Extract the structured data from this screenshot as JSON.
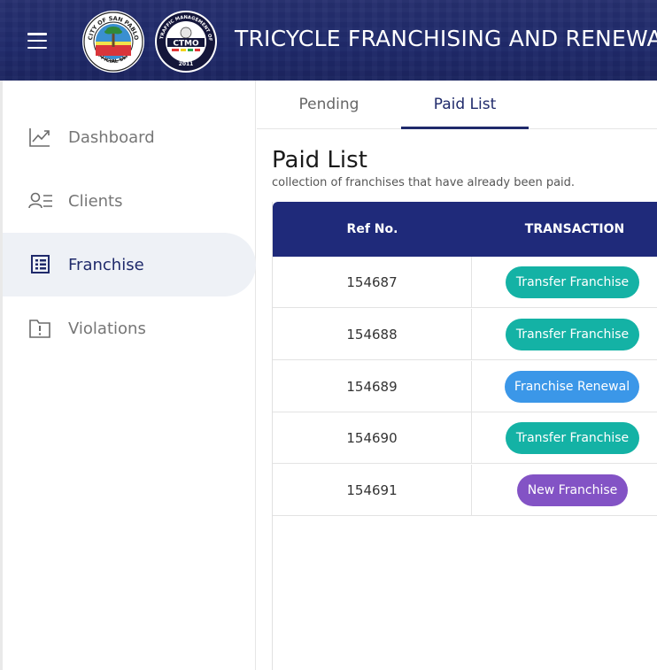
{
  "header": {
    "title": "TRICYCLE FRANCHISING AND RENEWAL",
    "menu_icon": "hamburger-menu-icon",
    "seal1_text": [
      "CITY OF SAN PABLO",
      "OFFICIAL SEAL"
    ],
    "seal2_text": [
      "CITY TRAFFIC MANAGEMENT OFFICE",
      "CTMO",
      "2011"
    ]
  },
  "sidebar": {
    "items": [
      {
        "label": "Dashboard",
        "icon": "trending-up-icon"
      },
      {
        "label": "Clients",
        "icon": "clients-list-icon"
      },
      {
        "label": "Franchise",
        "icon": "list-document-icon",
        "active": true
      },
      {
        "label": "Violations",
        "icon": "folder-alert-icon"
      }
    ]
  },
  "tabs": [
    {
      "label": "Pending"
    },
    {
      "label": "Paid List",
      "active": true
    }
  ],
  "main": {
    "title": "Paid List",
    "subtitle": "collection of franchises that have already been paid."
  },
  "table": {
    "headers": [
      "Ref No.",
      "TRANSACTION"
    ],
    "rows": [
      {
        "ref": "154687",
        "transaction": "Transfer Franchise",
        "type": "transfer"
      },
      {
        "ref": "154688",
        "transaction": "Transfer Franchise",
        "type": "transfer"
      },
      {
        "ref": "154689",
        "transaction": "Franchise Renewal",
        "type": "renewal"
      },
      {
        "ref": "154690",
        "transaction": "Transfer Franchise",
        "type": "transfer"
      },
      {
        "ref": "154691",
        "transaction": "New Franchise",
        "type": "new"
      }
    ]
  },
  "colors": {
    "brand": "#1f2a6b",
    "transfer": "#14b2a5",
    "renewal": "#3b97e8",
    "new": "#8353c5"
  }
}
